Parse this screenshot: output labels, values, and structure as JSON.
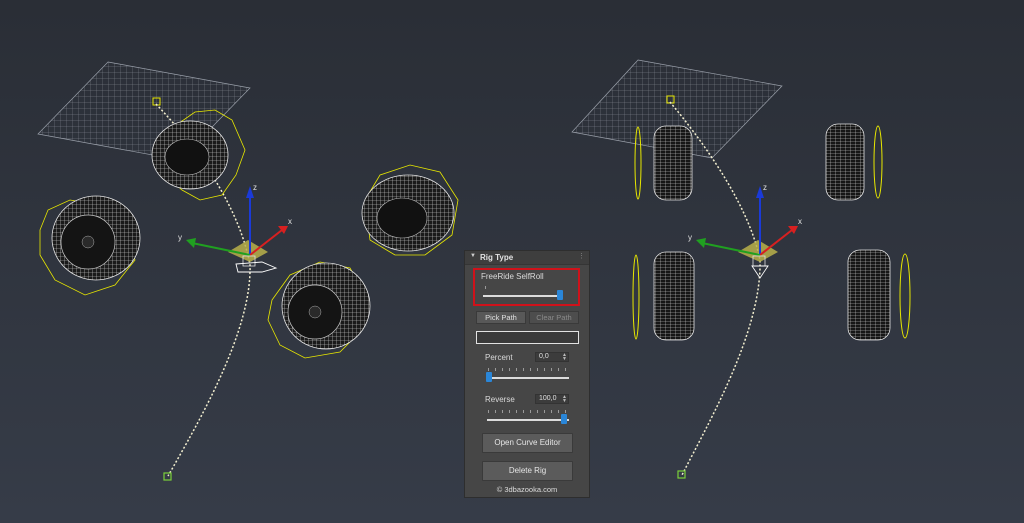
{
  "panel": {
    "title": "Rig Type",
    "rig_name": "FreeRide SelfRoll",
    "rig_slider_value": 1.0,
    "pick_path_label": "Pick Path",
    "clear_path_label": "Clear Path",
    "path_field_value": "",
    "percent_label": "Percent",
    "percent_value": "0,0",
    "percent_slider_value": 0.0,
    "reverse_label": "Reverse",
    "reverse_value": "100,0",
    "reverse_slider_value": 1.0,
    "open_curve_editor_label": "Open Curve Editor",
    "delete_rig_label": "Delete Rig",
    "credit": "© 3dbazooka.com"
  },
  "gizmo": {
    "x_label": "x",
    "y_label": "y",
    "z_label": "z"
  },
  "colors": {
    "accent": "#2a86d8",
    "highlight": "#d0121a",
    "selection": "#e8e800",
    "path": "#f3efd0"
  }
}
